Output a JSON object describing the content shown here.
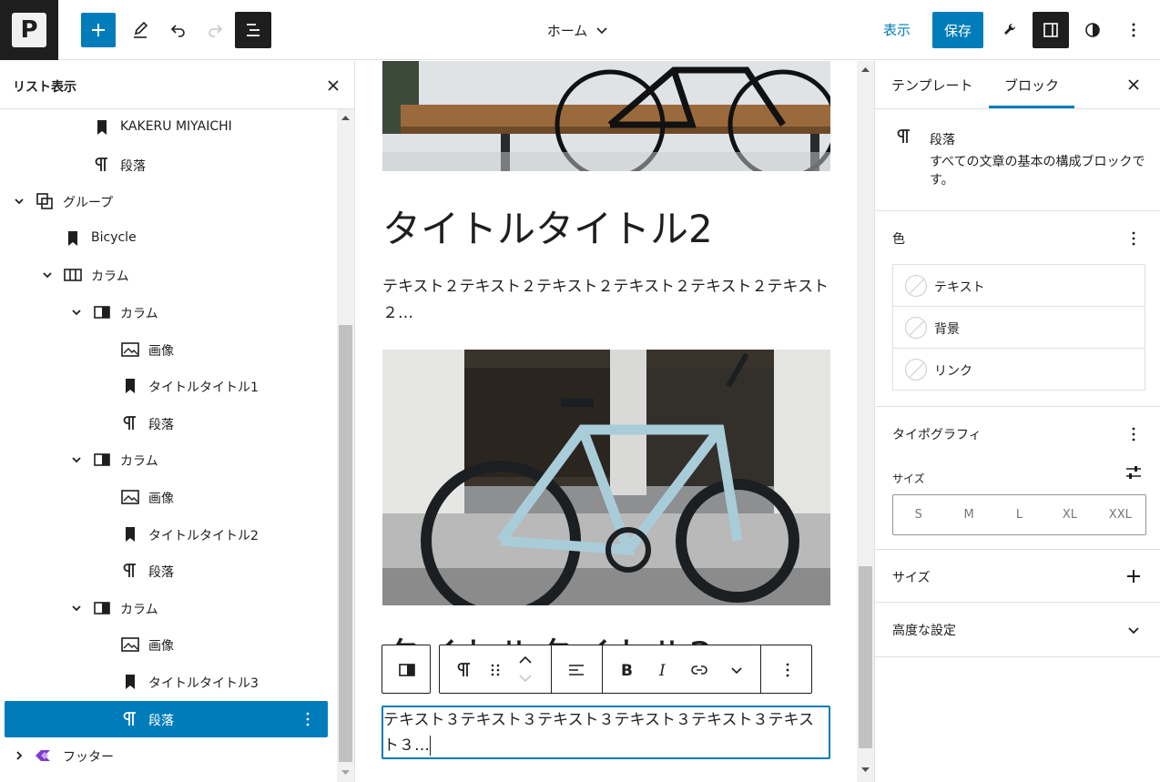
{
  "header": {
    "logo_letter": "P",
    "doc_title": "ホーム",
    "preview_label": "表示",
    "save_label": "保存"
  },
  "list_view": {
    "title": "リスト表示",
    "items": [
      {
        "label": "KAKERU MIYAICHI",
        "icon": "bookmark-icon",
        "depth": 3,
        "chevron": ""
      },
      {
        "label": "段落",
        "icon": "paragraph-icon",
        "depth": 3,
        "chevron": ""
      },
      {
        "label": "グループ",
        "icon": "group-icon",
        "depth": 1,
        "chevron": "down"
      },
      {
        "label": "Bicycle",
        "icon": "bookmark-icon",
        "depth": 2,
        "chevron": ""
      },
      {
        "label": "カラム",
        "icon": "columns-icon",
        "depth": 2,
        "chevron": "down"
      },
      {
        "label": "カラム",
        "icon": "column-icon",
        "depth": 3,
        "chevron": "down"
      },
      {
        "label": "画像",
        "icon": "image-icon",
        "depth": 4,
        "chevron": ""
      },
      {
        "label": "タイトルタイトル1",
        "icon": "bookmark-icon",
        "depth": 4,
        "chevron": ""
      },
      {
        "label": "段落",
        "icon": "paragraph-icon",
        "depth": 4,
        "chevron": ""
      },
      {
        "label": "カラム",
        "icon": "column-icon",
        "depth": 3,
        "chevron": "down"
      },
      {
        "label": "画像",
        "icon": "image-icon",
        "depth": 4,
        "chevron": ""
      },
      {
        "label": "タイトルタイトル2",
        "icon": "bookmark-icon",
        "depth": 4,
        "chevron": ""
      },
      {
        "label": "段落",
        "icon": "paragraph-icon",
        "depth": 4,
        "chevron": ""
      },
      {
        "label": "カラム",
        "icon": "column-icon",
        "depth": 3,
        "chevron": "down"
      },
      {
        "label": "画像",
        "icon": "image-icon",
        "depth": 4,
        "chevron": ""
      },
      {
        "label": "タイトルタイトル3",
        "icon": "bookmark-icon",
        "depth": 4,
        "chevron": ""
      },
      {
        "label": "段落",
        "icon": "paragraph-icon",
        "depth": 4,
        "chevron": "",
        "selected": true
      },
      {
        "label": "フッター",
        "icon": "template-part-icon",
        "depth": 1,
        "chevron": "right"
      }
    ]
  },
  "canvas": {
    "heading2": "タイトルタイトル2",
    "para2": "テキスト２テキスト２テキスト２テキスト２テキスト２テキスト２…",
    "heading3": "タイトルタイトル3",
    "para3": "テキスト３テキスト３テキスト３テキスト３テキスト３テキスト３…"
  },
  "sidebar": {
    "tabs": [
      "テンプレート",
      "ブロック"
    ],
    "active_tab": "ブロック",
    "block_name": "段落",
    "block_desc": "すべての文章の基本の構成ブロックです。",
    "color_title": "色",
    "colors": [
      "テキスト",
      "背景",
      "リンク"
    ],
    "typography_title": "タイポグラフィ",
    "size_label": "サイズ",
    "font_sizes": [
      "S",
      "M",
      "L",
      "XL",
      "XXL"
    ],
    "dimensions_title": "サイズ",
    "advanced_title": "高度な設定"
  },
  "colors": {
    "accent": "#007cba",
    "dark": "#1e1e1e",
    "footer_icon": "#7e3bd0"
  }
}
